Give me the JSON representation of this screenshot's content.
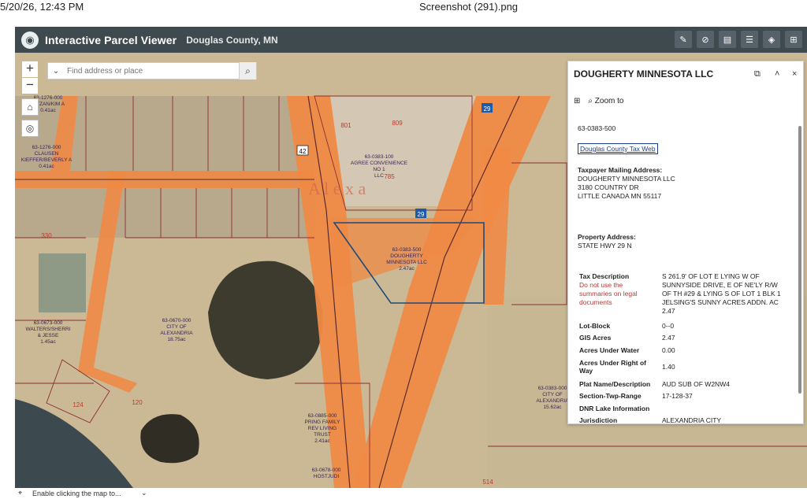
{
  "print_header": {
    "timestamp": "5/20/26, 12:43 PM",
    "filename": "Screenshot (291).png"
  },
  "app": {
    "title": "Interactive Parcel Viewer",
    "subtitle": "Douglas County, MN",
    "toolbar_icons": [
      "measure-icon",
      "link-icon",
      "print-icon",
      "legend-icon",
      "layers-icon",
      "basemap-icon"
    ]
  },
  "map_controls": {
    "zoom_in": "+",
    "zoom_out": "−",
    "search_placeholder": "Find address or place",
    "search_icon": "⌕",
    "home_icon": "⌂",
    "locate_icon": "◎"
  },
  "map_labels": {
    "highway_29_a": "29",
    "highway_29_b": "29",
    "highway_42": "42",
    "alexa_watermark": "A l e x a",
    "parcel_selected": [
      "63-0383-500",
      "DOUGHERTY",
      "MINNESOTA LLC",
      "2.47ac"
    ],
    "parcel_city": [
      "63-0670-000",
      "CITY OF",
      "ALEXANDRIA",
      "18.75ac"
    ],
    "parcel_walters": [
      "63-0673-000",
      "WALTERS/SHERRI",
      "& JESSE",
      "1.45ac"
    ],
    "parcel_agree": [
      "63-0383-100",
      "AGREE CONVENIENCE",
      "NO 1",
      "LLC"
    ],
    "parcel_pring": [
      "63-0885-000",
      "PRING FAMILY",
      "REV LIVING",
      "TRUST",
      "2.41ac"
    ],
    "parcel_city_right": [
      "63-0383-000",
      "CITY OF",
      "ALEXANDRIA",
      "15.62ac"
    ],
    "parcel_hostudi": [
      "63-0678-000",
      "HOSTJUDI"
    ],
    "parcel_kieffer": [
      "63-1276-000",
      "CLAUSEN",
      "KIEFFER/BEVERLY A",
      "0.41ac"
    ],
    "parcel_bitzan": [
      "63-1276-000",
      "BITZAN/KIM A",
      "0.41ac"
    ],
    "num_801": "801",
    "num_809": "809",
    "num_785": "785",
    "num_330": "330",
    "num_124": "124",
    "num_120": "120",
    "num_514": "514"
  },
  "popup": {
    "title": "DOUGHERTY MINNESOTA LLC",
    "zoom_label": "Zoom to",
    "parcel_id": "63-0383-500",
    "tax_link": "Douglas County Tax Web",
    "mailing_label": "Taxpayer Mailing Address:",
    "mailing_lines": [
      "DOUGHERTY MINNESOTA LLC",
      "3180 COUNTRY DR",
      "LITTLE CANADA MN 55117"
    ],
    "property_label": "Property Address:",
    "property_value": "STATE HWY 29 N",
    "tax_desc_label": "Tax Description",
    "tax_desc_note": [
      "Do not use the",
      "summaries on legal",
      "documents"
    ],
    "tax_desc_value": [
      "S 261.9' OF LOT E LYING W OF",
      "SUNNYSIDE DRIVE, E OF NE'LY R/W",
      "OF TH #29 & LYING S OF LOT 1 BLK 1",
      "JELSING'S SUNNY ACRES ADDN. AC",
      "2.47"
    ],
    "rows": [
      {
        "label": "Lot-Block",
        "value": "0--0"
      },
      {
        "label": "GIS Acres",
        "value": "2.47"
      },
      {
        "label": "Acres Under Water",
        "value": "0.00"
      },
      {
        "label": "Acres Under Right of Way",
        "value": "1.40"
      },
      {
        "label": "Plat Name/Description",
        "value": "AUD SUB OF W2NW4"
      },
      {
        "label": "Section-Twp-Range",
        "value": "17-128-37"
      },
      {
        "label": "DNR Lake Information",
        "value": ""
      },
      {
        "label": "Jurisdiction",
        "value": "ALEXANDRIA CITY"
      }
    ]
  },
  "status_bar": {
    "text": "Enable clicking the map to..."
  }
}
